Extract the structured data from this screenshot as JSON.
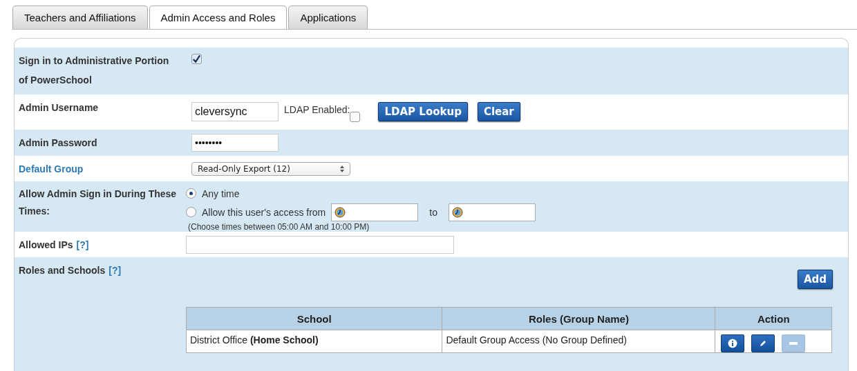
{
  "tabs": [
    {
      "label": "Teachers and Affiliations",
      "selected": false
    },
    {
      "label": "Admin Access and Roles",
      "selected": true
    },
    {
      "label": "Applications",
      "selected": false
    }
  ],
  "sign_in": {
    "label": "Sign in to Administrative Portion of PowerSchool",
    "checked": true
  },
  "username": {
    "label": "Admin Username",
    "value": "cleversync",
    "ldap_label": "LDAP Enabled:",
    "ldap_checked": false,
    "buttons": [
      "LDAP Lookup",
      "Clear"
    ]
  },
  "password": {
    "label": "Admin Password",
    "value": "••••••••"
  },
  "default_group": {
    "label": "Default Group",
    "value": "Read-Only Export (12)"
  },
  "times": {
    "label": "Allow Admin Sign in During These Times:",
    "options": [
      {
        "label": "Any time",
        "selected": true
      },
      {
        "label": "Allow this user's access from",
        "selected": false
      }
    ],
    "to_label": "to",
    "hint": "(Choose times between 05:00 AM and 10:00 PM)"
  },
  "allowed_ips": {
    "label": "Allowed IPs",
    "help": "[?]"
  },
  "roles": {
    "label": "Roles and Schools",
    "help": "[?]",
    "add_button": "Add",
    "table": {
      "columns": [
        "School",
        "Roles (Group Name)",
        "Action"
      ],
      "rows": [
        {
          "school": "District Office **(Home School)**",
          "roles": "Default Group Access (No Group Defined)",
          "actions": [
            {
              "kind": "info",
              "disabled": false
            },
            {
              "kind": "edit",
              "disabled": false
            },
            {
              "kind": "remove",
              "disabled": true
            }
          ]
        }
      ]
    }
  }
}
